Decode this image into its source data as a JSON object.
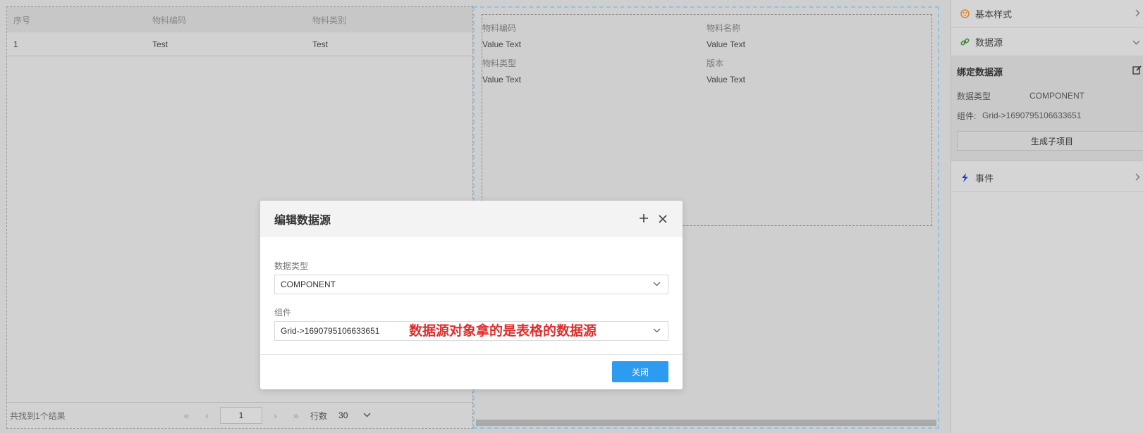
{
  "grid": {
    "columns": [
      "序号",
      "物料编码",
      "物料类别"
    ],
    "rows": [
      [
        "1",
        "Test",
        "Test"
      ]
    ],
    "footer": {
      "status": "共找到1个结果",
      "first": "«",
      "prev": "‹",
      "page": "1",
      "next": "›",
      "last": "»",
      "rows_label": "行数",
      "rows_value": "30"
    }
  },
  "form": {
    "fields": [
      {
        "label": "物料编码",
        "value": "Value Text"
      },
      {
        "label": "物料名称",
        "value": "Value Text"
      },
      {
        "label": "物料类型",
        "value": "Value Text"
      },
      {
        "label": "版本",
        "value": "Value Text"
      }
    ]
  },
  "properties": {
    "sections": {
      "basic_style": "基本样式",
      "data_source": "数据源",
      "events": "事件"
    },
    "binding": {
      "title": "绑定数据源",
      "type_label": "数据类型",
      "type_value": "COMPONENT",
      "component_label": "组件:",
      "component_value": "Grid->1690795106633651",
      "generate_button": "生成子项目"
    },
    "colors": {
      "style_icon": "#e0862a",
      "link_icon": "#3a8a3a",
      "event_icon": "#2a3fd1"
    }
  },
  "modal": {
    "title": "编辑数据源",
    "type_label": "数据类型",
    "type_value": "COMPONENT",
    "component_label": "组件",
    "component_value": "Grid->1690795106633651",
    "annotation": "数据源对象拿的是表格的数据源",
    "close_button": "关闭"
  }
}
